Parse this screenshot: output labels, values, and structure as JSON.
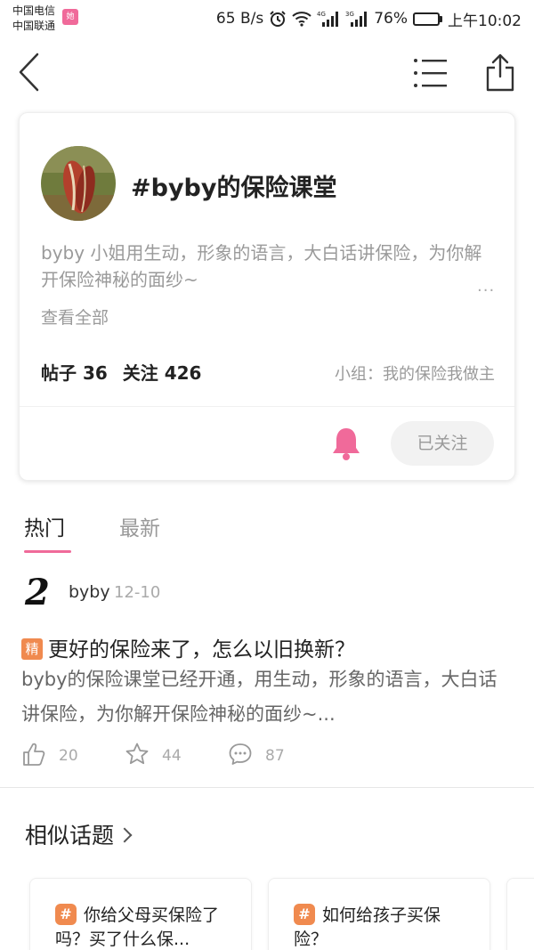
{
  "status_bar": {
    "carrier_1": "中国电信",
    "carrier_2": "中国联通",
    "app_badge": "她",
    "net_speed": "65 B/s",
    "signal_1_label": "4G",
    "signal_2_label": "3G",
    "battery_percent": "76%",
    "battery_level": 0.76,
    "time": "上午10:02"
  },
  "nav": {
    "back_icon": "chevron-left-icon",
    "list_icon": "list-icon",
    "share_icon": "share-icon"
  },
  "topic": {
    "title": "#byby的保险课堂",
    "description": "byby 小姐用生动，形象的语言，大白话讲保险，为你解开保险神秘的面纱~",
    "more": "...",
    "see_all": "查看全部",
    "posts_label": "帖子 36",
    "follows_label": "关注 426",
    "group": "小组：我的保险我做主",
    "follow_button": "已关注",
    "accent_color": "#f06a9a"
  },
  "tabs": [
    {
      "label": "热门",
      "active": true
    },
    {
      "label": "最新",
      "active": false
    }
  ],
  "post": {
    "author": "byby",
    "date": "12-10",
    "badge": "精",
    "title": "更好的保险来了，怎么以旧换新？",
    "excerpt": "byby的保险课堂已经开通，用生动，形象的语言，大白话讲保险，为你解开保险神秘的面纱~...",
    "likes": "20",
    "favorites": "44",
    "comments": "87"
  },
  "related": {
    "title": "相似话题",
    "cards": [
      {
        "icon": "#",
        "text": "你给父母买保险了吗？买了什么保..."
      },
      {
        "icon": "#",
        "text": "如何给孩子买保险？"
      }
    ]
  }
}
